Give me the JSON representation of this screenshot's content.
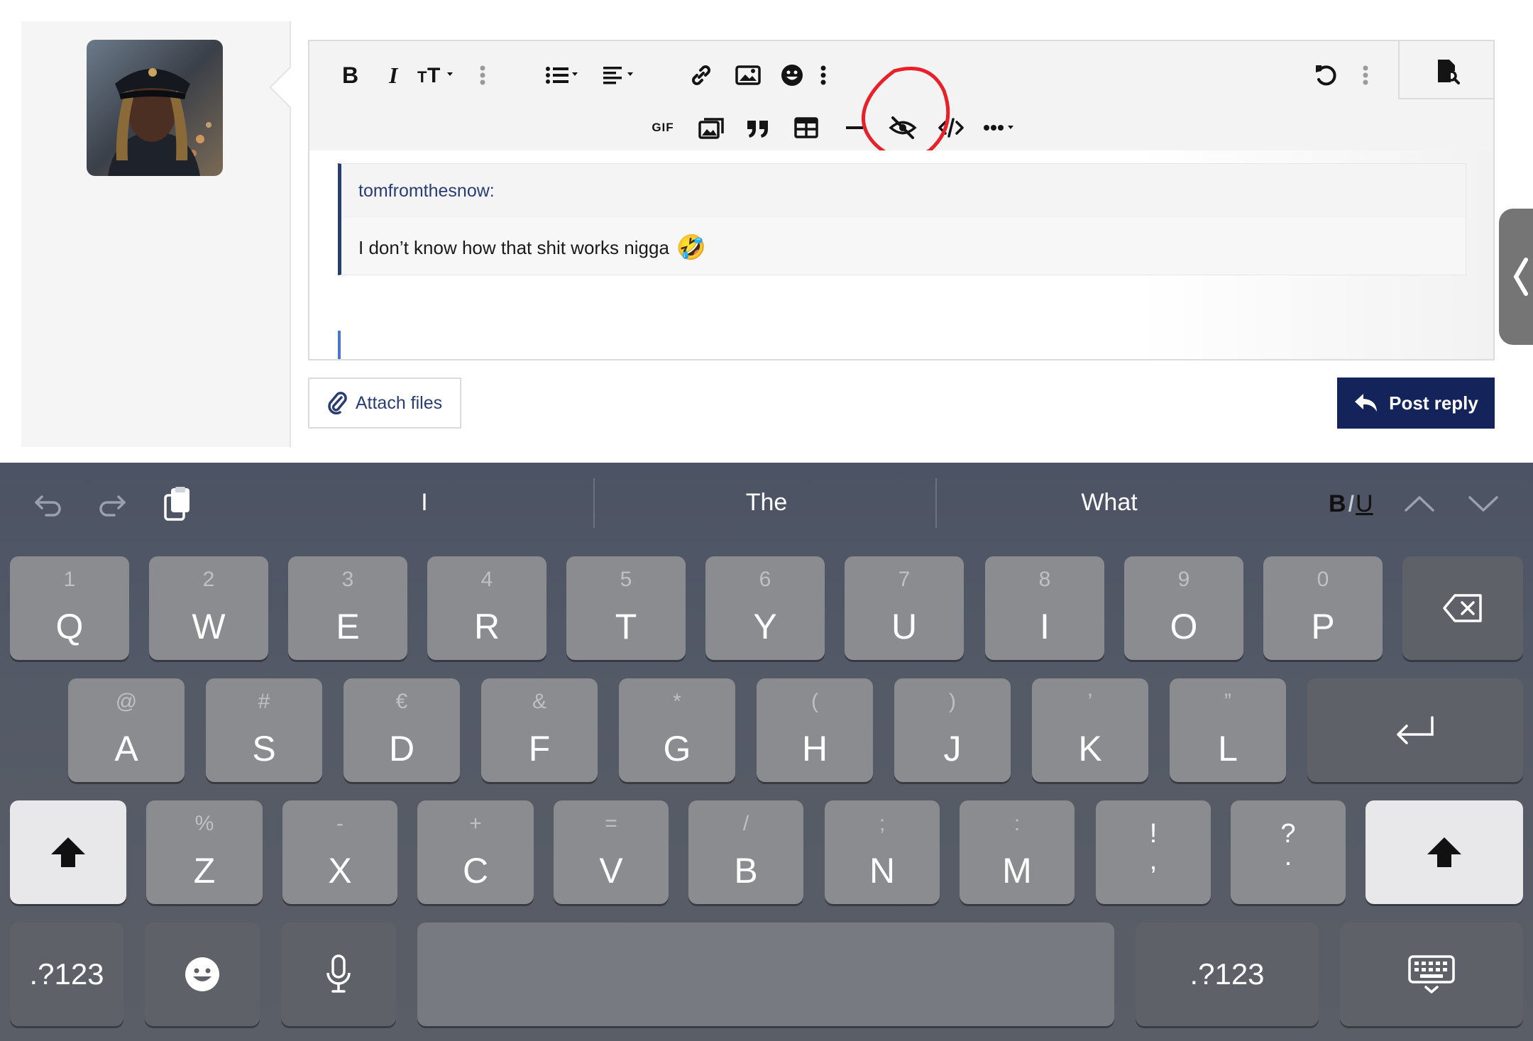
{
  "editor": {
    "quote_author": "tomfromthesnow:",
    "quote_text": "I don’t know how that shit works nigga",
    "quote_emoji": "🤣",
    "toolbar_gif_label": "GIF"
  },
  "actions": {
    "attach_label": "Attach files",
    "post_label": "Post reply"
  },
  "keyboard": {
    "suggestions": [
      "I",
      "The",
      "What"
    ],
    "format": {
      "b": "B",
      "i": "I",
      "u": "U"
    },
    "row1": [
      {
        "main": "Q",
        "sub": "1"
      },
      {
        "main": "W",
        "sub": "2"
      },
      {
        "main": "E",
        "sub": "3"
      },
      {
        "main": "R",
        "sub": "4"
      },
      {
        "main": "T",
        "sub": "5"
      },
      {
        "main": "Y",
        "sub": "6"
      },
      {
        "main": "U",
        "sub": "7"
      },
      {
        "main": "I",
        "sub": "8"
      },
      {
        "main": "O",
        "sub": "9"
      },
      {
        "main": "P",
        "sub": "0"
      }
    ],
    "row2": [
      {
        "main": "A",
        "sub": "@"
      },
      {
        "main": "S",
        "sub": "#"
      },
      {
        "main": "D",
        "sub": "€"
      },
      {
        "main": "F",
        "sub": "&"
      },
      {
        "main": "G",
        "sub": "*"
      },
      {
        "main": "H",
        "sub": "("
      },
      {
        "main": "J",
        "sub": ")"
      },
      {
        "main": "K",
        "sub": "’"
      },
      {
        "main": "L",
        "sub": "”"
      }
    ],
    "row3": [
      {
        "main": "Z",
        "sub": "%"
      },
      {
        "main": "X",
        "sub": "-"
      },
      {
        "main": "C",
        "sub": "+"
      },
      {
        "main": "V",
        "sub": "="
      },
      {
        "main": "B",
        "sub": "/"
      },
      {
        "main": "N",
        "sub": ";"
      },
      {
        "main": "M",
        "sub": ":"
      }
    ],
    "punct1": {
      "top": "!",
      "bottom": ","
    },
    "punct2": {
      "top": "?",
      "bottom": "."
    },
    "num_label": ".?123",
    "accent_color": "#14245b"
  }
}
